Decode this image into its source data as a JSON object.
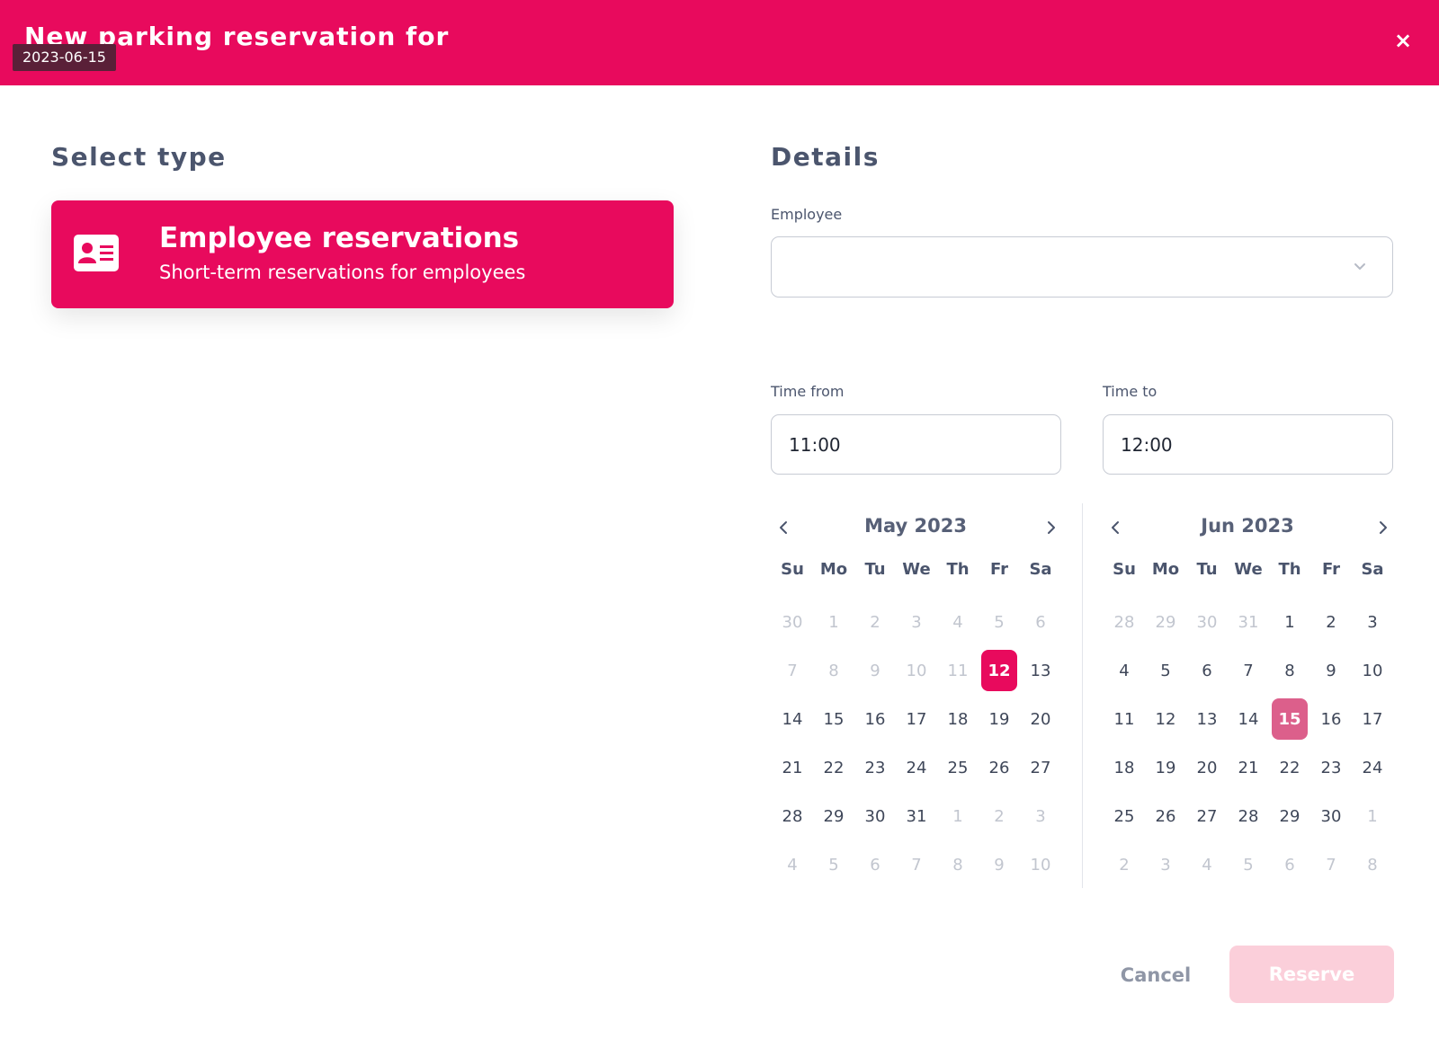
{
  "header": {
    "title": "New parking reservation for",
    "date_chip": "2023-06-15",
    "close_label": "×"
  },
  "select_type": {
    "heading": "Select type",
    "card": {
      "title": "Employee reservations",
      "subtitle": "Short-term reservations for employees",
      "icon": "id-card-icon"
    }
  },
  "details": {
    "heading": "Details",
    "employee_label": "Employee",
    "employee_value": "",
    "time_from_label": "Time from",
    "time_from_value": "11:00",
    "time_to_label": "Time to",
    "time_to_value": "12:00"
  },
  "calendars": [
    {
      "month_label": "May  2023",
      "weekdays": [
        "Su",
        "Mo",
        "Tu",
        "We",
        "Th",
        "Fr",
        "Sa"
      ],
      "days": [
        {
          "d": "30",
          "s": "muted"
        },
        {
          "d": "1",
          "s": "muted"
        },
        {
          "d": "2",
          "s": "muted"
        },
        {
          "d": "3",
          "s": "muted"
        },
        {
          "d": "4",
          "s": "muted"
        },
        {
          "d": "5",
          "s": "muted"
        },
        {
          "d": "6",
          "s": "muted"
        },
        {
          "d": "7",
          "s": "muted"
        },
        {
          "d": "8",
          "s": "muted"
        },
        {
          "d": "9",
          "s": "muted"
        },
        {
          "d": "10",
          "s": "muted"
        },
        {
          "d": "11",
          "s": "muted"
        },
        {
          "d": "12",
          "s": "sel"
        },
        {
          "d": "13",
          "s": ""
        },
        {
          "d": "14",
          "s": ""
        },
        {
          "d": "15",
          "s": ""
        },
        {
          "d": "16",
          "s": ""
        },
        {
          "d": "17",
          "s": ""
        },
        {
          "d": "18",
          "s": ""
        },
        {
          "d": "19",
          "s": ""
        },
        {
          "d": "20",
          "s": ""
        },
        {
          "d": "21",
          "s": ""
        },
        {
          "d": "22",
          "s": ""
        },
        {
          "d": "23",
          "s": ""
        },
        {
          "d": "24",
          "s": ""
        },
        {
          "d": "25",
          "s": ""
        },
        {
          "d": "26",
          "s": ""
        },
        {
          "d": "27",
          "s": ""
        },
        {
          "d": "28",
          "s": ""
        },
        {
          "d": "29",
          "s": ""
        },
        {
          "d": "30",
          "s": ""
        },
        {
          "d": "31",
          "s": ""
        },
        {
          "d": "1",
          "s": "muted"
        },
        {
          "d": "2",
          "s": "muted"
        },
        {
          "d": "3",
          "s": "muted"
        },
        {
          "d": "4",
          "s": "muted"
        },
        {
          "d": "5",
          "s": "muted"
        },
        {
          "d": "6",
          "s": "muted"
        },
        {
          "d": "7",
          "s": "muted"
        },
        {
          "d": "8",
          "s": "muted"
        },
        {
          "d": "9",
          "s": "muted"
        },
        {
          "d": "10",
          "s": "muted"
        }
      ]
    },
    {
      "month_label": "Jun  2023",
      "weekdays": [
        "Su",
        "Mo",
        "Tu",
        "We",
        "Th",
        "Fr",
        "Sa"
      ],
      "days": [
        {
          "d": "28",
          "s": "muted"
        },
        {
          "d": "29",
          "s": "muted"
        },
        {
          "d": "30",
          "s": "muted"
        },
        {
          "d": "31",
          "s": "muted"
        },
        {
          "d": "1",
          "s": ""
        },
        {
          "d": "2",
          "s": ""
        },
        {
          "d": "3",
          "s": ""
        },
        {
          "d": "4",
          "s": ""
        },
        {
          "d": "5",
          "s": ""
        },
        {
          "d": "6",
          "s": ""
        },
        {
          "d": "7",
          "s": ""
        },
        {
          "d": "8",
          "s": ""
        },
        {
          "d": "9",
          "s": ""
        },
        {
          "d": "10",
          "s": ""
        },
        {
          "d": "11",
          "s": ""
        },
        {
          "d": "12",
          "s": ""
        },
        {
          "d": "13",
          "s": ""
        },
        {
          "d": "14",
          "s": ""
        },
        {
          "d": "15",
          "s": "today"
        },
        {
          "d": "16",
          "s": ""
        },
        {
          "d": "17",
          "s": ""
        },
        {
          "d": "18",
          "s": ""
        },
        {
          "d": "19",
          "s": ""
        },
        {
          "d": "20",
          "s": ""
        },
        {
          "d": "21",
          "s": ""
        },
        {
          "d": "22",
          "s": ""
        },
        {
          "d": "23",
          "s": ""
        },
        {
          "d": "24",
          "s": ""
        },
        {
          "d": "25",
          "s": ""
        },
        {
          "d": "26",
          "s": ""
        },
        {
          "d": "27",
          "s": ""
        },
        {
          "d": "28",
          "s": ""
        },
        {
          "d": "29",
          "s": ""
        },
        {
          "d": "30",
          "s": ""
        },
        {
          "d": "1",
          "s": "muted"
        },
        {
          "d": "2",
          "s": "muted"
        },
        {
          "d": "3",
          "s": "muted"
        },
        {
          "d": "4",
          "s": "muted"
        },
        {
          "d": "5",
          "s": "muted"
        },
        {
          "d": "6",
          "s": "muted"
        },
        {
          "d": "7",
          "s": "muted"
        },
        {
          "d": "8",
          "s": "muted"
        }
      ]
    }
  ],
  "actions": {
    "cancel_label": "Cancel",
    "reserve_label": "Reserve"
  },
  "colors": {
    "brand": "#e80a5d",
    "today": "#dc5f8b",
    "reserve_disabled": "#fbcfda",
    "muted_day": "#c2c6cf"
  }
}
